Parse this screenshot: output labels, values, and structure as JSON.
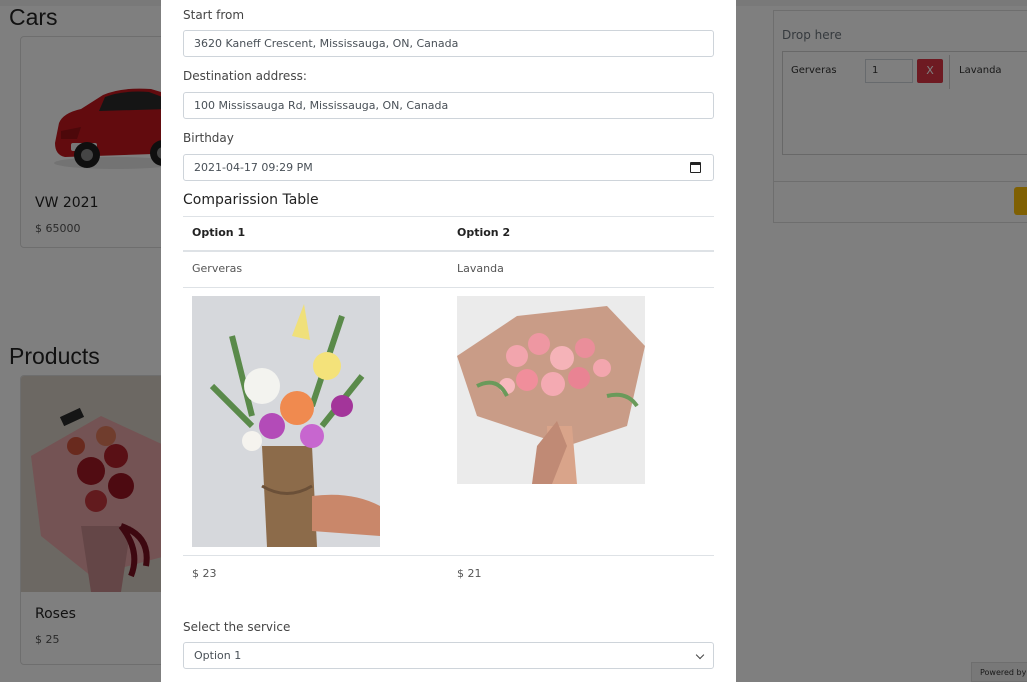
{
  "background": {
    "cars_heading": "Cars",
    "car_card": {
      "title": "VW 2021",
      "price": "$ 65000"
    },
    "products_heading": "Products",
    "product_card": {
      "title": "Roses",
      "price": "$ 25"
    },
    "cart": {
      "drop_label": "Drop here",
      "item_name": "Gerveras",
      "item_qty": "1",
      "remove_label": "X",
      "item_name_2": "Lavanda"
    },
    "powered_by": "Powered by"
  },
  "modal": {
    "start_label": "Start from",
    "start_value": "3620 Kaneff Crescent, Mississauga, ON, Canada",
    "destination_label": "Destination address:",
    "destination_value": "100 Mississauga Rd, Mississauga, ON, Canada",
    "birthday_label": "Birthday",
    "birthday_value": "2021-04-17 09:29 PM",
    "table_title": "Comparission Table",
    "table": {
      "headers": [
        "Option 1",
        "Option 2"
      ],
      "names": [
        "Gerveras",
        "Lavanda"
      ],
      "prices": [
        "$ 23",
        "$ 21"
      ]
    },
    "service_label": "Select the service",
    "service_selected": "Option 1"
  },
  "colors": {
    "danger": "#dc3545",
    "warning": "#ffc107",
    "overlay": "rgba(0,0,0,0.5)"
  },
  "icons": [
    "calendar-icon",
    "chevron-down-icon"
  ]
}
